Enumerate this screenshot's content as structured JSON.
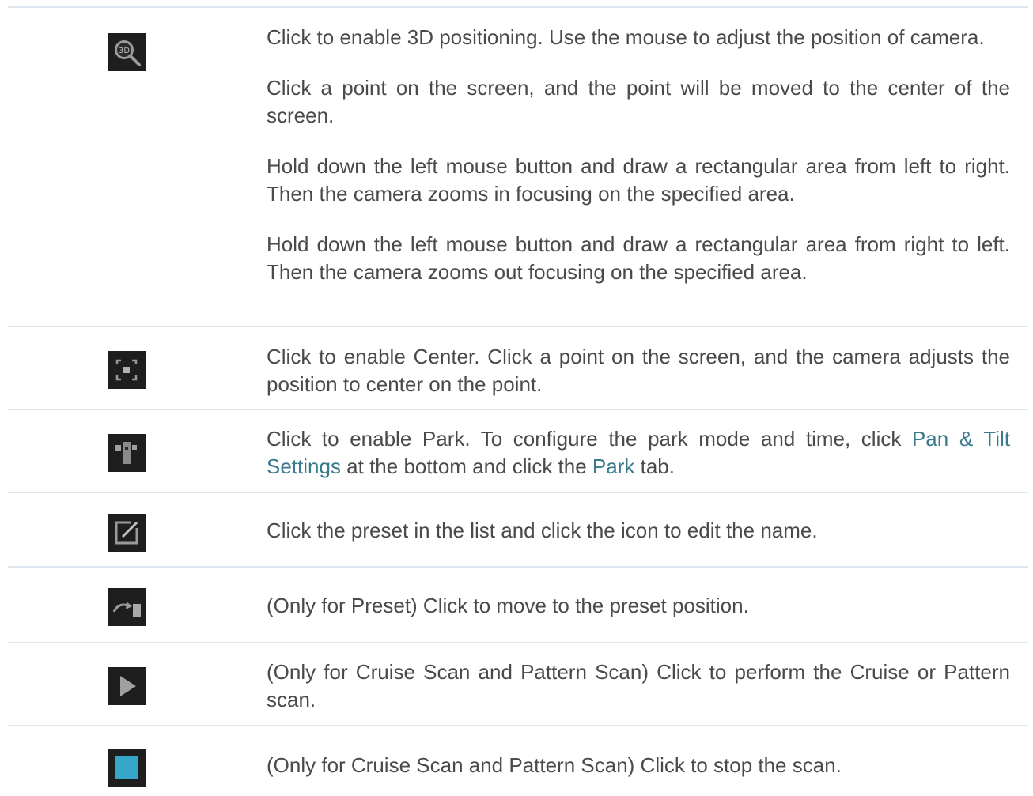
{
  "rows": [
    {
      "icon": "3d-positioning-icon",
      "paragraphs": [
        "Click to enable 3D positioning. Use the mouse to adjust the position of camera.",
        "Click a point on the screen, and the point will be moved to the center of the screen.",
        "Hold down the left mouse button and draw a rectangular area from left to right. Then the camera zooms in focusing on the specified area.",
        "Hold down the left mouse button and draw a rectangular area from right to left. Then the camera zooms out focusing on the specified area."
      ]
    },
    {
      "icon": "center-icon",
      "text": "Click to enable Center. Click a point on the screen, and the camera adjusts the position to center on the point."
    },
    {
      "icon": "park-icon",
      "text_before": "Click to enable Park. To configure the park mode and time, click ",
      "link1": "Pan & Tilt Settings",
      "text_middle": " at the bottom and click the ",
      "link2": "Park",
      "text_after": " tab."
    },
    {
      "icon": "edit-icon",
      "text": "Click the preset in the list and click the icon to edit the name."
    },
    {
      "icon": "move-to-preset-icon",
      "text": "(Only for Preset) Click to move to the preset position."
    },
    {
      "icon": "play-icon",
      "text": "(Only for Cruise Scan and Pattern Scan) Click to perform the Cruise or Pattern scan."
    },
    {
      "icon": "stop-icon",
      "text": "(Only for Cruise Scan and Pattern Scan) Click to stop the scan."
    }
  ],
  "colors": {
    "text": "#4a4a4a",
    "link": "#3a7a8c",
    "rule": "#dde6ee",
    "icon_bg": "#1e1e1e",
    "stop_accent": "#35a6c8"
  }
}
